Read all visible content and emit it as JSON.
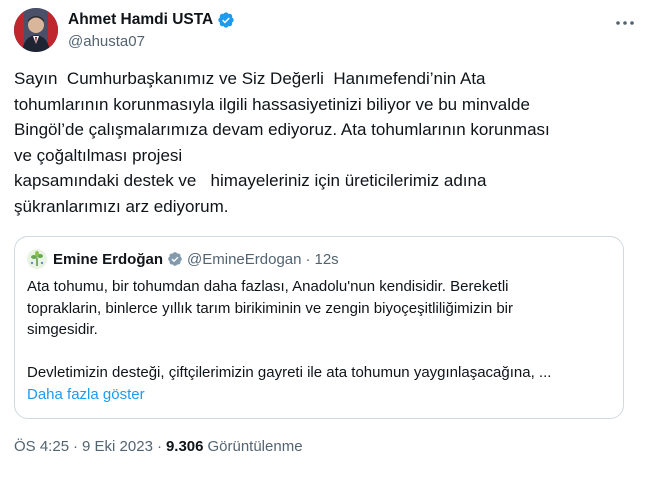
{
  "author": {
    "display_name": "Ahmet Hamdi USTA",
    "handle": "@ahusta07",
    "avatar_icon": "profile-photo",
    "verified_icon": "verified-badge-icon"
  },
  "more_icon": "more-options-icon",
  "tweet": {
    "text": "Sayın  Cumhurbaşkanımız ve Siz Değerli  Hanımefendi’nin Ata\ntohumlarının korunmasıyla ilgili hassasiyetinizi biliyor ve bu minvalde\nBingöl’de çalışmalarımıza devam ediyoruz. Ata tohumlarının korunması\nve çoğaltılması projesi\nkapsamındaki destek ve   himayeleriniz için üreticilerimiz adına\nşükranlarımızı arz ediyorum."
  },
  "quoted": {
    "display_name": "Emine Erdoğan",
    "handle": "@EmineErdogan",
    "separator": "·",
    "time": "12s",
    "text": "Ata tohumu, bir tohumdan daha fazlası, Anadolu'nun kendisidir. Bereketli\ntopraklarin, binlerce yıllık tarım birikiminin ve zengin biyoçeşitliliğimizin bir\nsimgesidir.\n\nDevletimizin desteği, çiftçilerimizin gayreti ile ata tohumun yaygınlaşacağına, ...",
    "show_more": "Daha fazla göster"
  },
  "footer": {
    "time": "ÖS 4:25",
    "separator": "·",
    "date": "9 Eki 2023",
    "views_count": "9.306",
    "views_label": "Görüntülenme"
  },
  "colors": {
    "accent": "#1d9bf0",
    "text": "#0f1419",
    "secondary": "#536471",
    "border": "#cfd9de"
  }
}
